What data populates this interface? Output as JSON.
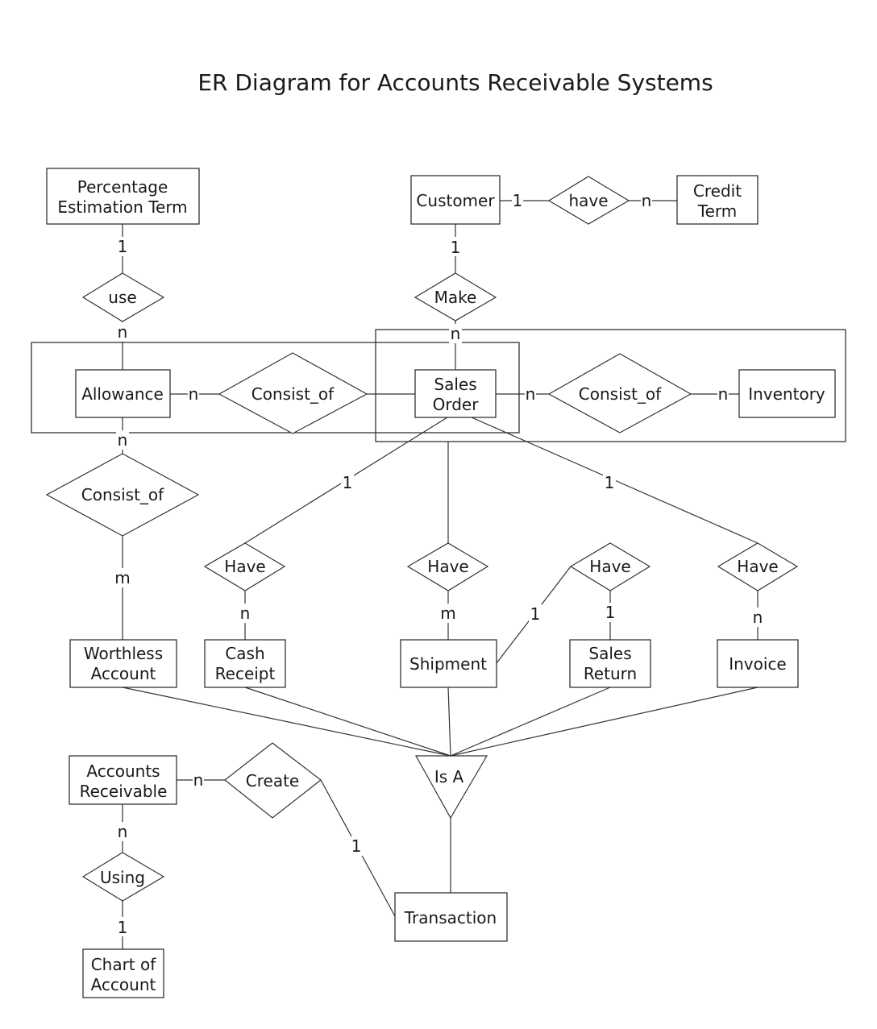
{
  "title": "ER Diagram for Accounts Receivable Systems",
  "entities": {
    "percentage_estimation_term": [
      "Percentage",
      "Estimation Term"
    ],
    "customer": [
      "Customer"
    ],
    "credit_term": [
      "Credit",
      "Term"
    ],
    "allowance": [
      "Allowance"
    ],
    "sales_order": [
      "Sales",
      "Order"
    ],
    "inventory": [
      "Inventory"
    ],
    "worthless_account": [
      "Worthless",
      "Account"
    ],
    "cash_receipt": [
      "Cash",
      "Receipt"
    ],
    "shipment": [
      "Shipment"
    ],
    "sales_return": [
      "Sales",
      "Return"
    ],
    "invoice": [
      "Invoice"
    ],
    "accounts_receivable": [
      "Accounts",
      "Receivable"
    ],
    "chart_of_account": [
      "Chart of",
      "Account"
    ],
    "transaction": [
      "Transaction"
    ]
  },
  "relationships": {
    "use": "use",
    "have_credit": "have",
    "make": "Make",
    "consist_of_allowance": "Consist_of",
    "consist_of_inventory": "Consist_of",
    "consist_of_worthless": "Consist_of",
    "have_cash": "Have",
    "have_shipment": "Have",
    "have_return": "Have",
    "have_invoice": "Have",
    "create": "Create",
    "using": "Using"
  },
  "isa_label": "Is A",
  "cardinalities": {
    "pet_use": "1",
    "use_allowance": "n",
    "customer_have": "1",
    "have_credit": "n",
    "customer_make": "1",
    "make_salesorder": "n",
    "allowance_consist": "n",
    "salesorder_consist_inv": "n",
    "consist_inventory": "n",
    "allowance_consist_worthless": "n",
    "consist_worthless": "m",
    "salesorder_have_cash": "1",
    "have_cash": "n",
    "have_shipment": "m",
    "salesorder_have_invoice": "1",
    "have_invoice": "n",
    "shipment_have_return": "1",
    "have_return": "1",
    "ar_create": "n",
    "create_transaction": "1",
    "ar_using": "n",
    "using_chart": "1"
  }
}
